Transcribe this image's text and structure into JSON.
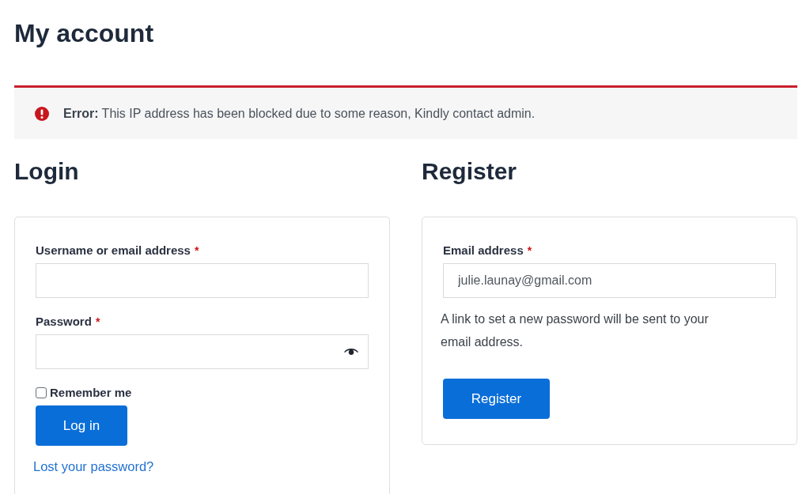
{
  "page_title": "My account",
  "notice": {
    "kind": "error",
    "text": "**Error:** This IP address has been blocked due to some reason, Kindly contact admin."
  },
  "login": {
    "heading": "Login",
    "fields": [
      {
        "kind": "text",
        "label": "Username or email address",
        "required_mark": "*"
      },
      {
        "kind": "password",
        "label": "Password",
        "required_mark": "*"
      }
    ],
    "remember": {
      "label": "Remember me",
      "checked": false
    },
    "button": "Log in",
    "link": "Lost your password?"
  },
  "register": {
    "heading": "Register",
    "fields": [
      {
        "kind": "email",
        "label": "Email address",
        "required_mark": "*",
        "value": "julie.launay@gmail.com"
      }
    ],
    "note": "A link to set a new password will be sent to your email address.",
    "button": "Register"
  }
}
